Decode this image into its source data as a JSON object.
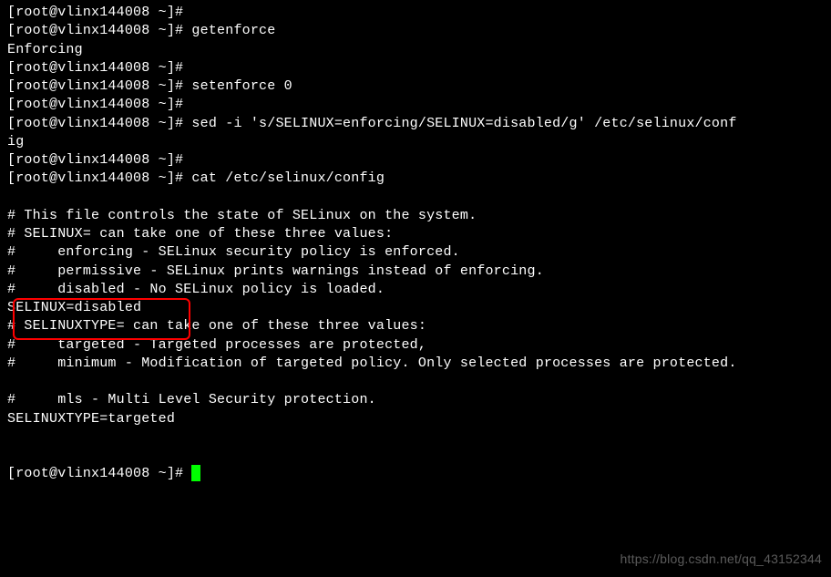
{
  "terminal": {
    "prompt": "[root@vlinx144008 ~]#",
    "lines": [
      {
        "type": "prompt",
        "cmd": ""
      },
      {
        "type": "prompt",
        "cmd": "getenforce"
      },
      {
        "type": "output",
        "text": "Enforcing"
      },
      {
        "type": "prompt",
        "cmd": ""
      },
      {
        "type": "prompt",
        "cmd": "setenforce 0"
      },
      {
        "type": "prompt",
        "cmd": ""
      },
      {
        "type": "prompt",
        "cmd": "sed -i 's/SELINUX=enforcing/SELINUX=disabled/g' /etc/selinux/conf"
      },
      {
        "type": "output",
        "text": "ig"
      },
      {
        "type": "prompt",
        "cmd": ""
      },
      {
        "type": "prompt",
        "cmd": "cat /etc/selinux/config"
      },
      {
        "type": "blank"
      },
      {
        "type": "output",
        "text": "# This file controls the state of SELinux on the system."
      },
      {
        "type": "output",
        "text": "# SELINUX= can take one of these three values:"
      },
      {
        "type": "output",
        "text": "#     enforcing - SELinux security policy is enforced."
      },
      {
        "type": "output",
        "text": "#     permissive - SELinux prints warnings instead of enforcing."
      },
      {
        "type": "output",
        "text": "#     disabled - No SELinux policy is loaded."
      },
      {
        "type": "output",
        "text": "SELINUX=disabled"
      },
      {
        "type": "output",
        "text": "# SELINUXTYPE= can take one of these three values:"
      },
      {
        "type": "output",
        "text": "#     targeted - Targeted processes are protected,"
      },
      {
        "type": "output",
        "text": "#     minimum - Modification of targeted policy. Only selected processes are protected."
      },
      {
        "type": "blank"
      },
      {
        "type": "output",
        "text": "#     mls - Multi Level Security protection."
      },
      {
        "type": "output",
        "text": "SELINUXTYPE=targeted"
      },
      {
        "type": "blank"
      },
      {
        "type": "blank"
      },
      {
        "type": "prompt_cursor",
        "cmd": ""
      }
    ]
  },
  "watermark": "https://blog.csdn.net/qq_43152344"
}
